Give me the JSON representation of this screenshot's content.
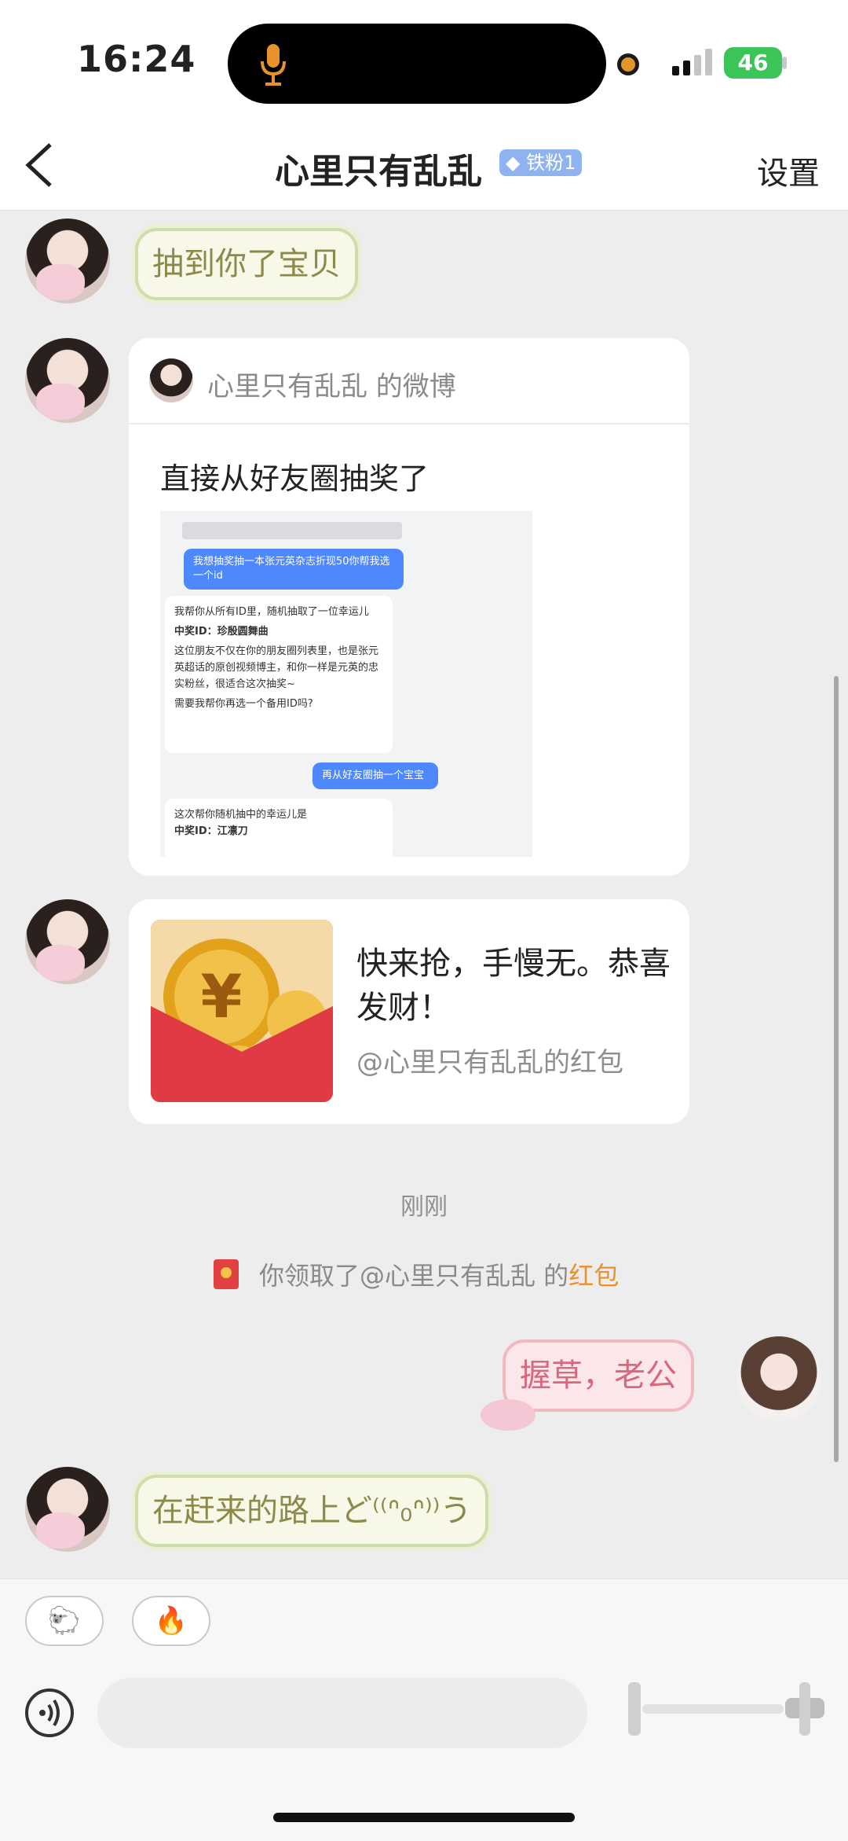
{
  "status": {
    "time": "16:24",
    "battery": "46"
  },
  "nav": {
    "title": "心里只有乱乱",
    "badge": "铁粉1",
    "settings": "设置"
  },
  "messages": {
    "m1": "抽到你了宝贝",
    "weibo": {
      "header": "心里只有乱乱 的微博",
      "text": "直接从好友圈抽奖了",
      "shot_q1": "我想抽奖抽一本张元英杂志折现50你帮我选一个id",
      "shot_a1_line1": "我帮你从所有ID里，随机抽取了一位幸运儿",
      "shot_a1_prize": "中奖ID：珍殷圆舞曲",
      "shot_a1_line2": "这位朋友不仅在你的朋友圈列表里，也是张元英超话的原创视频博主，和你一样是元英的忠实粉丝，很适合这次抽奖~",
      "shot_a1_line3": "需要我帮你再选一个备用ID吗?",
      "shot_q2": "再从好友圈抽一个宝宝",
      "shot_a2_line1": "这次帮你随机抽中的幸运儿是",
      "shot_a2_prize": "中奖ID：江凛刀"
    },
    "redpacket": {
      "title": "快来抢，手慢无。恭喜发财！",
      "sub": "@心里只有乱乱的红包"
    },
    "timestamp": "刚刚",
    "system": {
      "prefix": "你领取了@心里只有乱乱 的",
      "link": "红包"
    },
    "m_me": "握草，老公",
    "m_last": "在赶来的路上ど⁽⁽ᐢ₀ᐢ⁾⁾う"
  },
  "quick_replies": [
    "🐑",
    "🔥"
  ],
  "colors": {
    "accent_link": "#e8912d",
    "island": "#000000"
  }
}
